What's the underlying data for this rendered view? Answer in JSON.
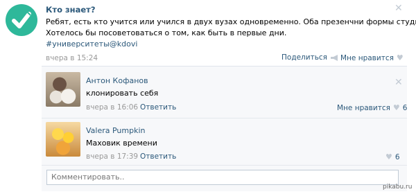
{
  "post": {
    "title": "Кто знает?",
    "text_line1": "Ребят, есть кто учится или учился в двух вузах одновременно. Оба презенчни формы студиа?",
    "text_line2": "Хотелось бы посоветоваться о том, как быть в первые дни.",
    "hashtag": "#университеты@kdovi",
    "date": "вчера в 15:24",
    "share_label": "Поделиться",
    "like_label": "Мне нравится"
  },
  "comments": [
    {
      "author": "Антон Кофанов",
      "text": "клонировать себя",
      "date": "вчера в 16:06",
      "reply_label": "Ответить",
      "like_label": "Мне нравится",
      "likes": "6"
    },
    {
      "author": "Valera Pumpkin",
      "text": "Маховик времени",
      "date": "вчера в 17:39",
      "reply_label": "Ответить",
      "likes": "6"
    }
  ],
  "comment_input": {
    "placeholder": "Комментировать.."
  },
  "watermark": "pikabu.ru",
  "colors": {
    "accent": "#2b587a",
    "logo": "#2eb89a",
    "muted": "#999999"
  }
}
